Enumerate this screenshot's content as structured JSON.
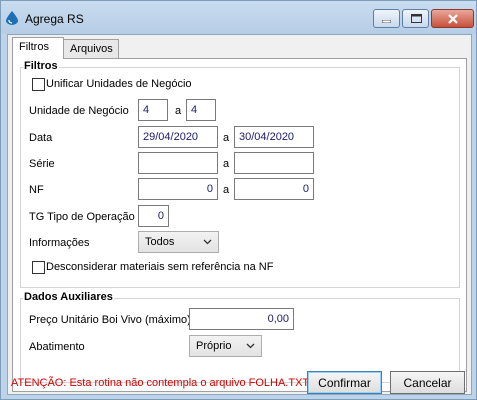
{
  "window": {
    "title": "Agrega RS"
  },
  "tabs": [
    {
      "label": "Filtros",
      "active": true
    },
    {
      "label": "Arquivos",
      "active": false
    }
  ],
  "filtros": {
    "group_title": "Filtros",
    "unificar_label": "Unificar Unidades de Negócio",
    "unificar_checked": false,
    "unidade_label": "Unidade de Negócio",
    "unidade_from": "4",
    "unidade_sep": "a",
    "unidade_to": "4",
    "data_label": "Data",
    "data_from": "29/04/2020",
    "data_sep": "a",
    "data_to": "30/04/2020",
    "serie_label": "Série",
    "serie_from": "",
    "serie_sep": "a",
    "serie_to": "",
    "nf_label": "NF",
    "nf_from": "0",
    "nf_sep": "a",
    "nf_to": "0",
    "tg_label": "TG Tipo de Operação",
    "tg_value": "0",
    "informacoes_label": "Informações",
    "informacoes_value": "Todos",
    "desconsiderar_label": "Desconsiderar materiais sem referência na NF",
    "desconsiderar_checked": false
  },
  "dados": {
    "group_title": "Dados Auxiliares",
    "preco_label": "Preço Unitário Boi Vivo (máximo)",
    "preco_value": "0,00",
    "abatimento_label": "Abatimento",
    "abatimento_value": "Próprio"
  },
  "footer": {
    "warning": "ATENÇÃO: Esta rotina não contempla o arquivo FOLHA.TXT.",
    "confirm_label": "Confirmar",
    "cancel_label": "Cancelar"
  },
  "colors": {
    "warning": "#d40000",
    "field_text": "#1a1a6e"
  }
}
